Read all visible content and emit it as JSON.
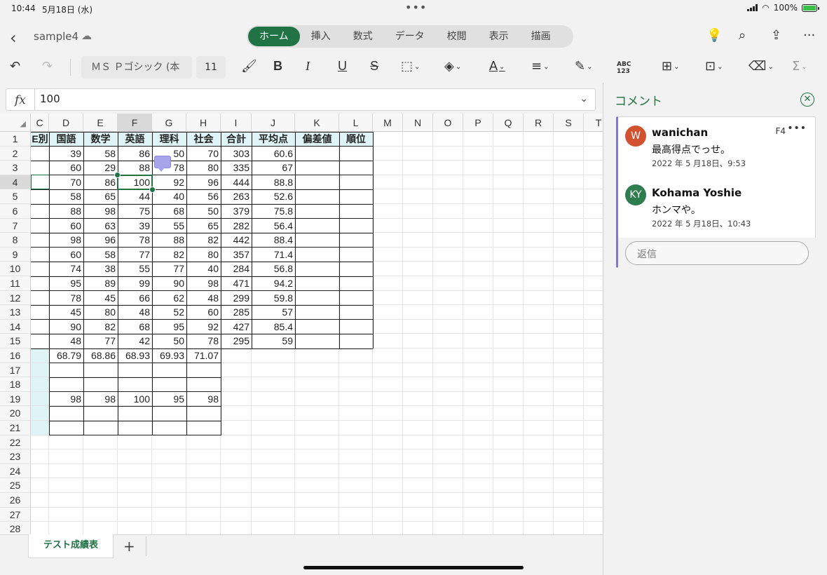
{
  "status": {
    "time": "10:44",
    "date": "5月18日 (水)",
    "battery": "100%"
  },
  "title": {
    "file_name": "sample4"
  },
  "tabs": [
    "ホーム",
    "挿入",
    "数式",
    "データ",
    "校閲",
    "表示",
    "描画"
  ],
  "toolbar": {
    "font_name": "ＭＳ Ｐゴシック (本",
    "font_size": "11",
    "abc_label": "ABC\n123"
  },
  "formula_bar": {
    "fx": "fx",
    "value": "100"
  },
  "grid": {
    "column_headers": [
      "C",
      "D",
      "E",
      "F",
      "G",
      "H",
      "I",
      "J",
      "K",
      "L",
      "M",
      "N",
      "O",
      "P",
      "Q",
      "R",
      "S",
      "T"
    ],
    "selected_column": "F",
    "selected_row": 4,
    "table_header": [
      "E別",
      "国語",
      "数学",
      "英語",
      "理科",
      "社会",
      "合計",
      "平均点",
      "偏差値",
      "順位"
    ],
    "rows": [
      [
        "39",
        "58",
        "86",
        "50",
        "70",
        "303",
        "60.6"
      ],
      [
        "60",
        "29",
        "88",
        "78",
        "80",
        "335",
        "67"
      ],
      [
        "70",
        "86",
        "100",
        "92",
        "96",
        "444",
        "88.8"
      ],
      [
        "58",
        "65",
        "44",
        "40",
        "56",
        "263",
        "52.6"
      ],
      [
        "88",
        "98",
        "75",
        "68",
        "50",
        "379",
        "75.8"
      ],
      [
        "60",
        "63",
        "39",
        "55",
        "65",
        "282",
        "56.4"
      ],
      [
        "98",
        "96",
        "78",
        "88",
        "82",
        "442",
        "88.4"
      ],
      [
        "60",
        "58",
        "77",
        "82",
        "80",
        "357",
        "71.4"
      ],
      [
        "74",
        "38",
        "55",
        "77",
        "40",
        "284",
        "56.8"
      ],
      [
        "95",
        "89",
        "99",
        "90",
        "98",
        "471",
        "94.2"
      ],
      [
        "78",
        "45",
        "66",
        "62",
        "48",
        "299",
        "59.8"
      ],
      [
        "45",
        "80",
        "48",
        "52",
        "60",
        "285",
        "57"
      ],
      [
        "90",
        "82",
        "68",
        "95",
        "92",
        "427",
        "85.4"
      ],
      [
        "48",
        "77",
        "42",
        "50",
        "78",
        "295",
        "59"
      ]
    ],
    "row16": [
      "68.79",
      "68.86",
      "68.93",
      "69.93",
      "71.07"
    ],
    "row19": [
      "98",
      "98",
      "100",
      "95",
      "98"
    ]
  },
  "sheet_tab": "テスト成績表",
  "comments": {
    "title": "コメント",
    "cell_ref": "F4",
    "entries": [
      {
        "initials": "W",
        "name": "wanichan",
        "text": "最高得点でっせ。",
        "date": "2022 年 5 月18日、9:53",
        "color": "#d2522f"
      },
      {
        "initials": "KY",
        "name": "Kohama Yoshie",
        "text": "ホンマや。",
        "date": "2022 年 5 月18日、10:43",
        "color": "#2e7d4f"
      }
    ],
    "reply_placeholder": "返信"
  },
  "colors": {
    "accent": "#217346",
    "comment_accent": "#7e79d4",
    "header_fill": "#dff4f6"
  }
}
